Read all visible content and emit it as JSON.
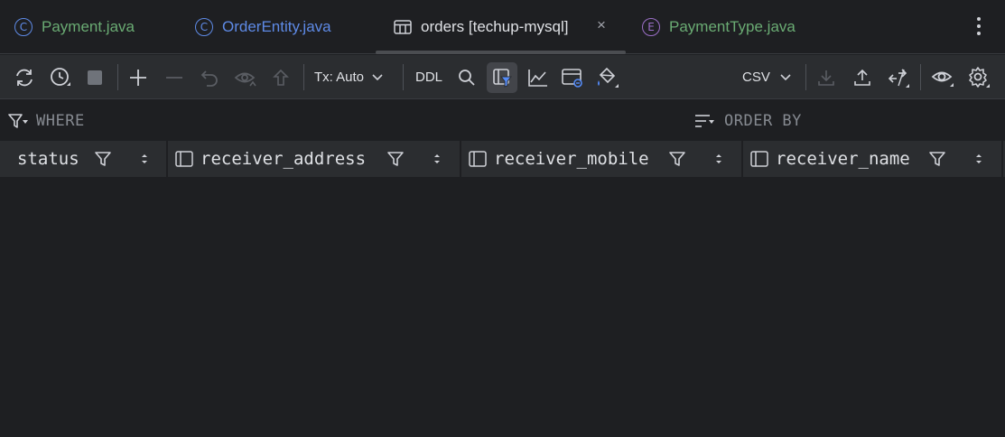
{
  "tabs": [
    {
      "label": "Payment.java",
      "badge": "C"
    },
    {
      "label": "OrderEntity.java",
      "badge": "C"
    },
    {
      "label": "orders [techup-mysql]",
      "close": "×"
    },
    {
      "label": "PaymentType.java",
      "badge": "E"
    }
  ],
  "toolbar": {
    "tx_mode": "Tx: Auto",
    "ddl": "DDL",
    "export_format": "CSV"
  },
  "filter": {
    "where": "WHERE",
    "order_by": "ORDER BY"
  },
  "columns": [
    {
      "name": "status"
    },
    {
      "name": "receiver_address"
    },
    {
      "name": "receiver_mobile"
    },
    {
      "name": "receiver_name"
    }
  ],
  "colors": {
    "background": "#1e1f22",
    "toolbar": "#2b2d30",
    "java_class_green": "#6aab73",
    "java_class_blue": "#5e8ae6",
    "enum_purple": "#9b6fc7"
  }
}
